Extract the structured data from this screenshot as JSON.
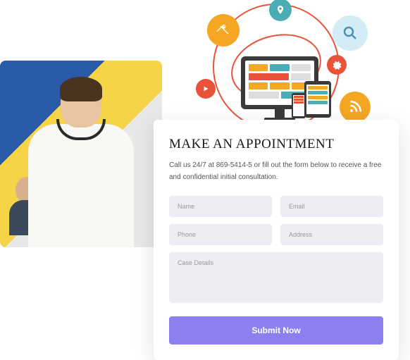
{
  "form": {
    "title": "MAKE AN APPOINTMENT",
    "subtitle": "Call us 24/7 at 869-5414-5 or fill out the form below to receive a free and confidential initial consultation.",
    "fields": {
      "name_ph": "Name",
      "email_ph": "Email",
      "phone_ph": "Phone",
      "address_ph": "Address",
      "details_ph": "Case Details"
    },
    "submit_label": "Submit Now"
  },
  "icons": {
    "pin": "📍",
    "tools": "✖",
    "search": "🔍",
    "gears": "⚙",
    "play": "▶",
    "rss": "☰"
  }
}
